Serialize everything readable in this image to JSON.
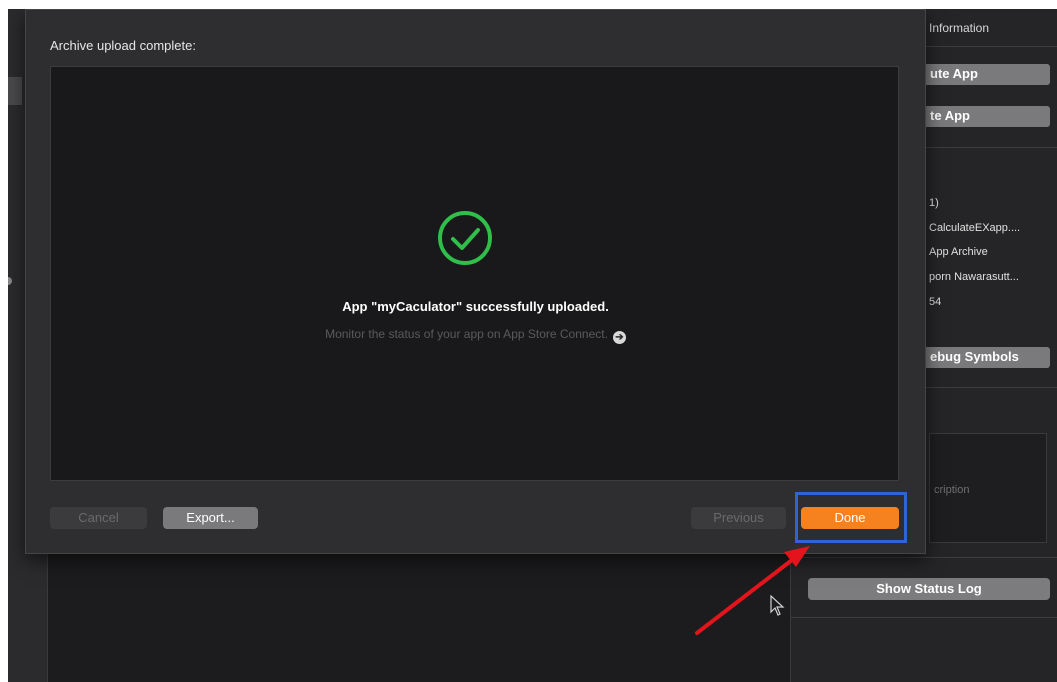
{
  "dialog": {
    "title": "Archive upload complete:",
    "message": "App \"myCaculator\" successfully uploaded.",
    "subtext": "Monitor the status of your app on App Store Connect.",
    "buttons": {
      "cancel": "Cancel",
      "export": "Export...",
      "previous": "Previous",
      "done": "Done"
    }
  },
  "right_panel": {
    "header": "Information",
    "distribute_button": "ute App",
    "validate_button": "te App",
    "info_lines": [
      "1)",
      "CalculateEXapp....",
      "App Archive",
      "porn Nawarasutt...",
      "54"
    ],
    "debug_button": "ebug Symbols",
    "description_placeholder": "cription",
    "status_log_button": "Show Status Log"
  },
  "icons": {
    "success": "checkmark-circle-icon",
    "arrow": "arrow-right-circle-icon"
  },
  "colors": {
    "accent_done": "#f5821f",
    "success_green": "#2fbf4a",
    "highlight_blue": "#2e64d4",
    "annotation_red": "#e3141b"
  }
}
